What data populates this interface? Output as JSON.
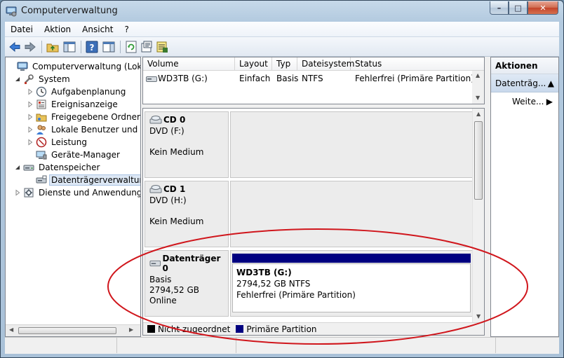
{
  "window": {
    "title": "Computerverwaltung",
    "caption": {
      "minimize": "–",
      "maximize": "□",
      "close": "✕"
    }
  },
  "menu": [
    "Datei",
    "Aktion",
    "Ansicht",
    "?"
  ],
  "toolbar": [
    "back-icon",
    "forward-icon",
    "up-folder-icon",
    "show-tree-icon",
    "help-icon",
    "view-icon",
    "refresh-icon",
    "properties-icon",
    "export-icon"
  ],
  "tree": {
    "root": "Computerverwaltung (Lokal)",
    "system": "System",
    "system_children": [
      "Aufgabenplanung",
      "Ereignisanzeige",
      "Freigegebene Ordner",
      "Lokale Benutzer und Gru",
      "Leistung",
      "Geräte-Manager"
    ],
    "storage": "Datenspeicher",
    "storage_children": [
      "Datenträgerverwaltung"
    ],
    "services": "Dienste und Anwendungen"
  },
  "volume_list": {
    "columns": [
      "Volume",
      "Layout",
      "Typ",
      "Dateisystem",
      "Status"
    ],
    "rows": [
      {
        "volume": "WD3TB (G:)",
        "layout": "Einfach",
        "typ": "Basis",
        "dateisystem": "NTFS",
        "status": "Fehlerfrei (Primäre Partition)"
      }
    ]
  },
  "disks": [
    {
      "name": "CD 0",
      "lines": [
        "DVD (F:)",
        "",
        "Kein Medium"
      ]
    },
    {
      "name": "CD 1",
      "lines": [
        "DVD (H:)",
        "",
        "Kein Medium"
      ]
    },
    {
      "name": "Datenträger 0",
      "lines": [
        "Basis",
        "2794,52 GB",
        "Online"
      ],
      "partition": {
        "name": "WD3TB  (G:)",
        "size": "2794,52 GB NTFS",
        "status": "Fehlerfrei (Primäre Partition)"
      }
    }
  ],
  "legend": [
    {
      "label": "Nicht zugeordnet",
      "color": "#000000"
    },
    {
      "label": "Primäre Partition",
      "color": "#000080"
    }
  ],
  "actions": {
    "header": "Aktionen",
    "section": "Datenträg...",
    "more": "Weite..."
  },
  "colors": {
    "primary_partition": "#000080",
    "annotation": "#d0161c"
  }
}
